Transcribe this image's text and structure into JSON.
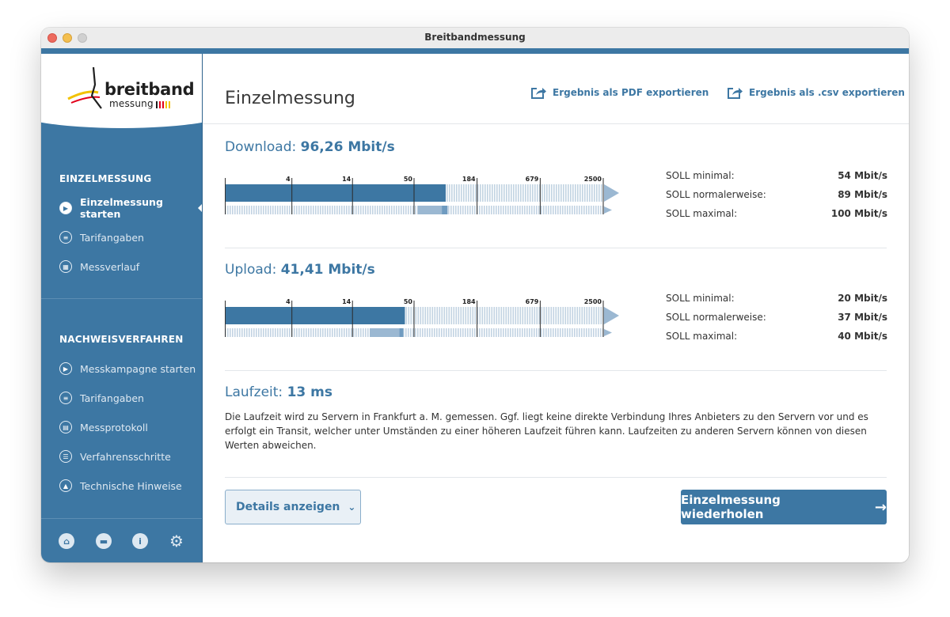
{
  "window": {
    "title": "Breitbandmessung"
  },
  "logo": {
    "line1": "breitband",
    "line2": "messung"
  },
  "sidebar": {
    "section1": "EINZELMESSUNG",
    "items1": [
      {
        "label": "Einzelmessung starten",
        "icon": "play-icon",
        "active": true
      },
      {
        "label": "Tarifangaben",
        "icon": "tariff-icon"
      },
      {
        "label": "Messverlauf",
        "icon": "calendar-icon"
      }
    ],
    "section2": "NACHWEISVERFAHREN",
    "items2": [
      {
        "label": "Messkampagne starten",
        "icon": "play-icon"
      },
      {
        "label": "Tarifangaben",
        "icon": "tariff-icon"
      },
      {
        "label": "Messprotokoll",
        "icon": "protocol-icon"
      },
      {
        "label": "Verfahrensschritte",
        "icon": "list-icon"
      },
      {
        "label": "Technische Hinweise",
        "icon": "warning-icon"
      }
    ],
    "footer_icons": [
      "home-icon",
      "chat-icon",
      "info-icon",
      "settings-icon"
    ]
  },
  "main": {
    "title": "Einzelmessung",
    "export_pdf": "Ergebnis als PDF exportieren",
    "export_csv": "Ergebnis als .csv exportieren",
    "scale_ticks": [
      "4",
      "14",
      "50",
      "184",
      "679",
      "2500"
    ],
    "download": {
      "label": "Download:",
      "value": "96,26 Mbit/s",
      "measured_mbit": 96.26,
      "soll": [
        {
          "label": "SOLL minimal:",
          "value": "54 Mbit/s",
          "mbit": 54
        },
        {
          "label": "SOLL normalerweise:",
          "value": "89 Mbit/s",
          "mbit": 89
        },
        {
          "label": "SOLL maximal:",
          "value": "100 Mbit/s",
          "mbit": 100
        }
      ]
    },
    "upload": {
      "label": "Upload:",
      "value": "41,41 Mbit/s",
      "measured_mbit": 41.41,
      "soll": [
        {
          "label": "SOLL minimal:",
          "value": "20 Mbit/s",
          "mbit": 20
        },
        {
          "label": "SOLL normalerweise:",
          "value": "37 Mbit/s",
          "mbit": 37
        },
        {
          "label": "SOLL maximal:",
          "value": "40 Mbit/s",
          "mbit": 40
        }
      ]
    },
    "latency": {
      "label": "Laufzeit:",
      "value": "13 ms",
      "description": "Die Laufzeit wird zu Servern in Frankfurt a. M. gemessen. Ggf. liegt keine direkte Verbindung Ihres Anbieters zu den Servern vor und es erfolgt ein Transit, welcher unter Umständen zu einer höheren Laufzeit führen kann. Laufzeiten zu anderen Servern können von diesen Werten abweichen."
    },
    "details_button": "Details anzeigen",
    "repeat_button": "Einzelmessung wiederholen"
  },
  "colors": {
    "accent": "#3d77a3",
    "accent_light": "#9bb8d2",
    "stripe": "#c2d3e2"
  }
}
